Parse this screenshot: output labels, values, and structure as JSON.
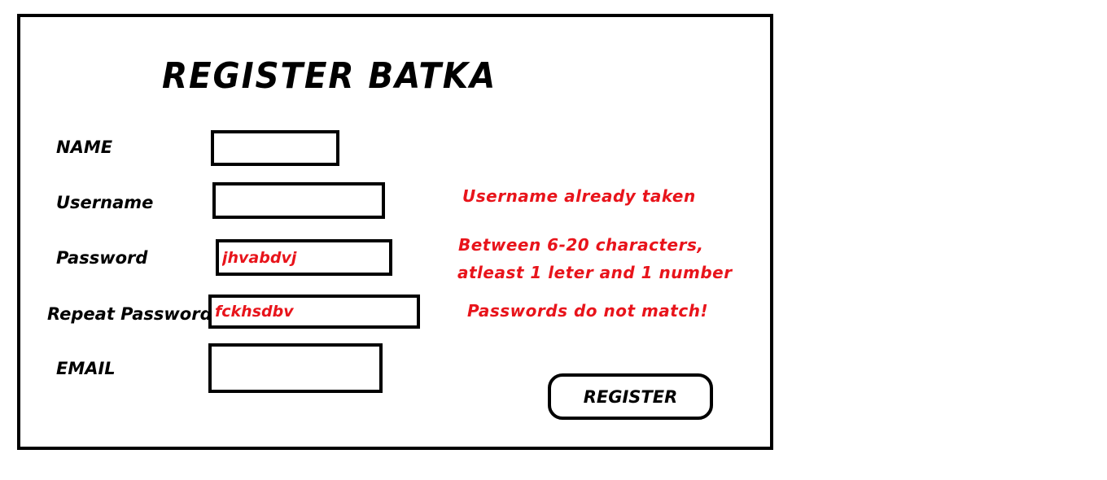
{
  "form": {
    "title": "REGISTER BATKA",
    "name_label": "NAME",
    "name_value": "",
    "username_label": "Username",
    "username_value": "",
    "username_error": "Username already taken",
    "password_label": "Password",
    "password_value": "jhvabdvj",
    "password_error_line1": "Between 6-20 characters,",
    "password_error_line2": "atleast 1 leter and 1 number",
    "repeat_label": "Repeat Password",
    "repeat_value": "fckhsdbv",
    "repeat_error": "Passwords do not match!",
    "email_label": "EMAIL",
    "email_value": "",
    "register_label": "REGISTER"
  },
  "colors": {
    "error": "#e8141b",
    "border": "#000000",
    "background": "#ffffff"
  }
}
